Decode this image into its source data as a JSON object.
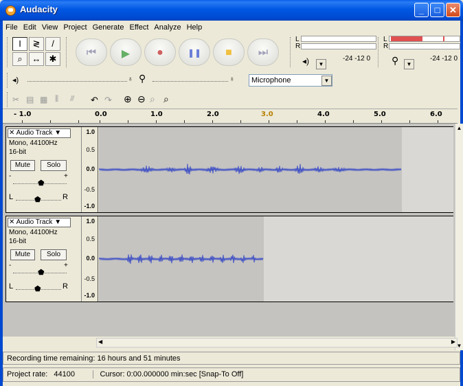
{
  "window": {
    "title": "Audacity",
    "min": "_",
    "max": "□",
    "close": "✕"
  },
  "menu": [
    "File",
    "Edit",
    "View",
    "Project",
    "Generate",
    "Effect",
    "Analyze",
    "Help"
  ],
  "tools": {
    "select": "I",
    "envelope": "≷",
    "draw": "/",
    "zoom": "⌕",
    "timeshift": "↔",
    "multi": "✱"
  },
  "transport": {
    "skip_start": "⏮",
    "play": "▶",
    "record": "●",
    "pause": "❚❚",
    "stop": "■",
    "skip_end": "⏭"
  },
  "meters": {
    "play_L": "L",
    "play_R": "R",
    "play_ticks": "-24 -12 0",
    "rec_L": "L",
    "rec_R": "R",
    "rec_ticks": "-24 -12 0"
  },
  "mixer": {
    "input_source": "Microphone"
  },
  "ruler": {
    "labels": [
      "- 1.0",
      "0.0",
      "1.0",
      "2.0",
      "3.0",
      "4.0",
      "5.0",
      "6.0"
    ]
  },
  "tracks": [
    {
      "name": "Audio Track",
      "info1": "Mono, 44100Hz",
      "info2": "16-bit",
      "mute": "Mute",
      "solo": "Solo",
      "gain_minus": "-",
      "gain_plus": "+",
      "pan_L": "L",
      "pan_R": "R",
      "scale": [
        "1.0",
        "0.5",
        "0.0",
        "-0.5",
        "-1.0"
      ]
    },
    {
      "name": "Audio Track",
      "info1": "Mono, 44100Hz",
      "info2": "16-bit",
      "mute": "Mute",
      "solo": "Solo",
      "gain_minus": "-",
      "gain_plus": "+",
      "pan_L": "L",
      "pan_R": "R",
      "scale": [
        "1.0",
        "0.5",
        "0.0",
        "-0.5",
        "-1.0"
      ]
    }
  ],
  "status": {
    "recording": "Recording time remaining: 16 hours and 51 minutes",
    "rate_label": "Project rate:",
    "rate_value": "44100",
    "cursor": "Cursor: 0:00.000000 min:sec  [Snap-To Off]"
  },
  "colors": {
    "titlebar": "#0049d0",
    "wave": "#3e4fc4",
    "track_bg": "#c5c4c1",
    "meter_red": "#e05050"
  }
}
